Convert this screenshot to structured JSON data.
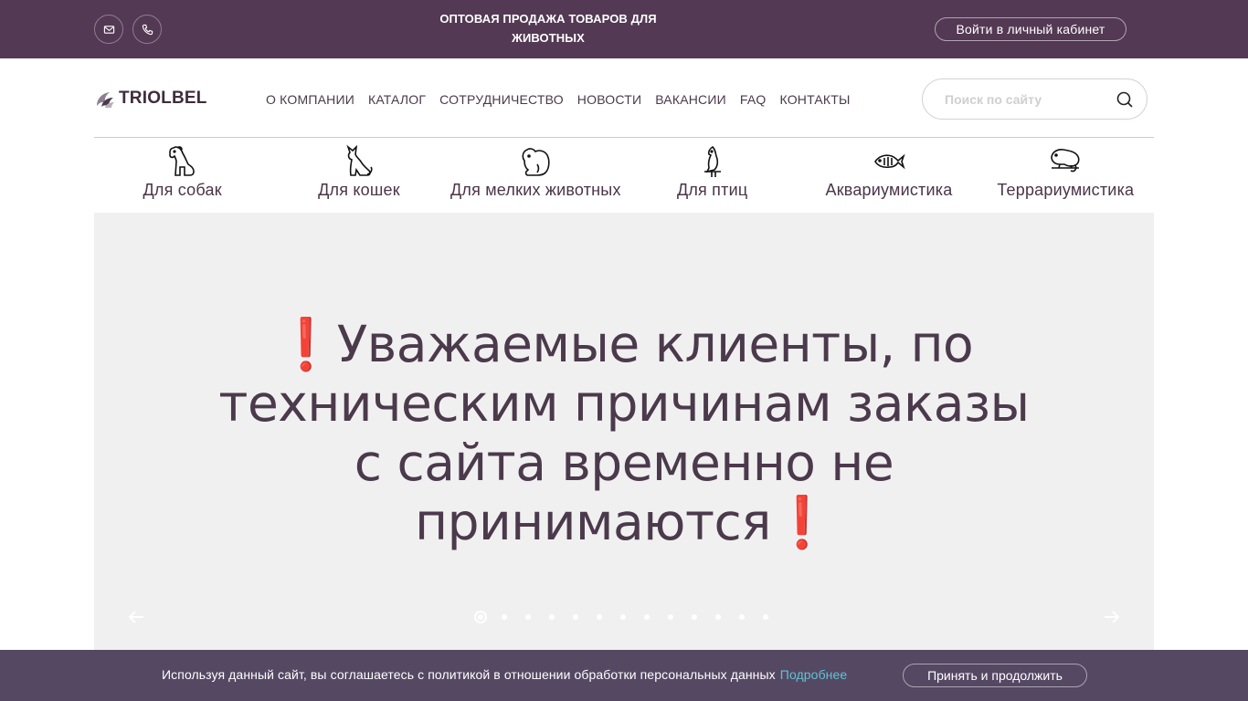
{
  "topbar": {
    "tagline": "ОПТОВАЯ ПРОДАЖА ТОВАРОВ ДЛЯ ЖИВОТНЫХ",
    "login_label": "Войти в личный кабинет",
    "icons": [
      "mail-icon",
      "phone-icon"
    ]
  },
  "header": {
    "logo_text": "TRIOLBEL",
    "nav": [
      "О КОМПАНИИ",
      "КАТАЛОГ",
      "СОТРУДНИЧЕСТВО",
      "НОВОСТИ",
      "ВАКАНСИИ",
      "FAQ",
      "КОНТАКТЫ"
    ],
    "search": {
      "placeholder": "Поиск по сайту",
      "value": ""
    }
  },
  "categories": [
    {
      "label": "Для собак",
      "icon": "dog-icon"
    },
    {
      "label": "Для кошек",
      "icon": "cat-icon"
    },
    {
      "label": "Для мелких животных",
      "icon": "rodent-icon"
    },
    {
      "label": "Для птиц",
      "icon": "bird-icon"
    },
    {
      "label": "Аквариумистика",
      "icon": "fish-icon"
    },
    {
      "label": "Террариумистика",
      "icon": "lizard-icon"
    }
  ],
  "slider": {
    "headline": "Уважаемые клиенты, по техническим причинам заказы с сайта временно не принимаются",
    "slide_count": 13,
    "active_slide": 1
  },
  "cookie": {
    "text": "Используя данный сайт, вы соглашаетесь с политикой в отношении обработки персональных данных",
    "link": "Подробнее",
    "accept_label": "Принять и продолжить"
  },
  "colors": {
    "brand": "#533953",
    "cookie_bar": "#554863",
    "accent_red": "#c0163a",
    "link": "#5ec4d4",
    "slider_bg": "#f1f0f1"
  }
}
